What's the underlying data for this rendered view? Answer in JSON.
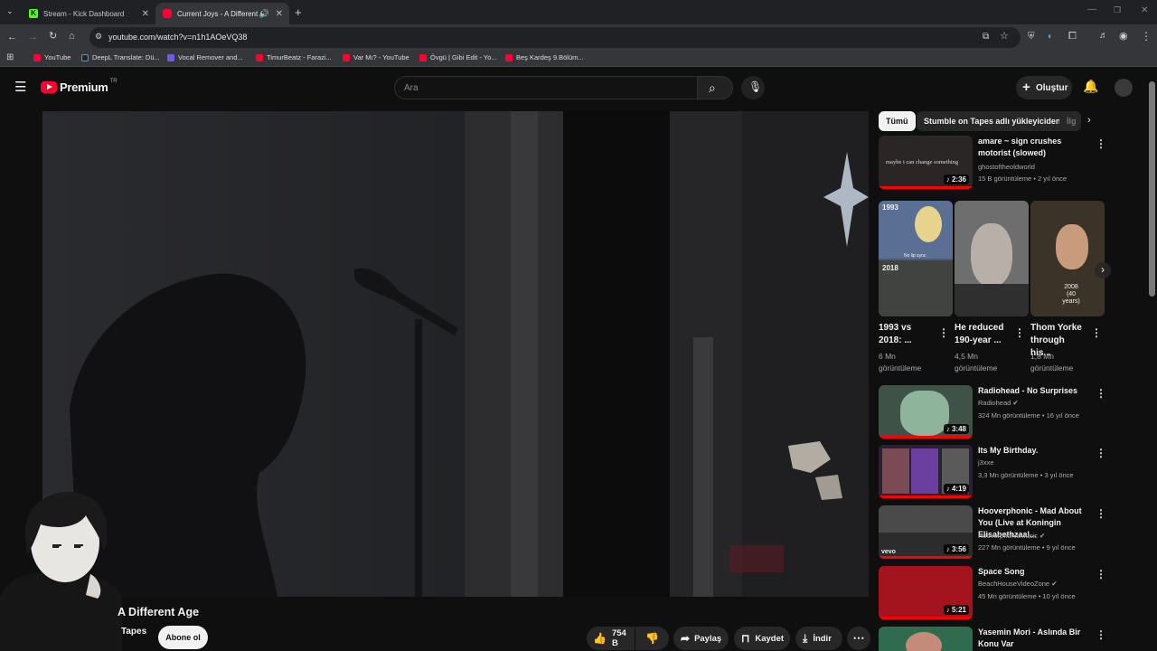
{
  "browser": {
    "tabs": [
      {
        "title": "Stream - Kick Dashboard",
        "favicon_color": "#53fc18"
      },
      {
        "title": "Current Joys - A Different A",
        "favicon_color": "#ff0033"
      }
    ],
    "url": "youtube.com/watch?v=n1h1AOeVQ38",
    "bookmarks": [
      {
        "label": "YouTube",
        "color": "#ff0033"
      },
      {
        "label": "DeepL Translate: Dü...",
        "color": "#0f2b46"
      },
      {
        "label": "Vocal Remover and...",
        "color": "#6c5ce7"
      },
      {
        "label": "TimurBeatz - Farazi...",
        "color": "#ff0033"
      },
      {
        "label": "Var Mı? - YouTube",
        "color": "#ff0033"
      },
      {
        "label": "Övgü | Gibi Edit - Yo...",
        "color": "#ff0033"
      },
      {
        "label": "Beş Kardeş 9.Bölüm...",
        "color": "#ff0033"
      }
    ]
  },
  "youtube": {
    "logo_text": "Premium",
    "logo_badge": "TR",
    "search_placeholder": "Ara",
    "create_label": "Oluştur"
  },
  "video": {
    "title": "A Different Age",
    "channel": "Tapes",
    "subscribe_label": "Abone ol",
    "likes": "754 B",
    "share_label": "Paylaş",
    "save_label": "Kaydet",
    "download_label": "İndir"
  },
  "chips": [
    "Tümü",
    "Stumble on Tapes adlı yükleyiciden",
    "İlg"
  ],
  "recommendations_top": [
    {
      "title": "amare ~ sign crushes motorist (slowed)",
      "channel": "ghostoftheoldworld",
      "meta": "15 B görüntüleme • 2 yıl önce",
      "duration": "2:36",
      "thumb_caption": "maybe i can change something"
    }
  ],
  "shorts": [
    {
      "title": "1993 vs 2018: ...",
      "views": "6 Mn görüntüleme",
      "caption_top": "1993",
      "caption_mid": "No lip sync",
      "caption_bottom": "2018"
    },
    {
      "title": "He reduced 190-year ...",
      "views": "4,5 Mn görüntüleme"
    },
    {
      "title": "Thom Yorke through his...",
      "views": "1,8 Mn görüntüleme",
      "caption_a": "2008",
      "caption_b": "(40 years)"
    }
  ],
  "recommendations": [
    {
      "title": "Radiohead - No Surprises",
      "channel": "Radiohead",
      "meta": "324 Mn görüntüleme • 16 yıl önce",
      "duration": "3:48"
    },
    {
      "title": "Its My Birthday.",
      "channel": "j3xxe",
      "meta": "3,3 Mn görüntüleme • 3 yıl önce",
      "duration": "4:19"
    },
    {
      "title": "Hooverphonic - Mad About You (Live at Koningin Elisabethzaal...",
      "channel": "HooverphonicMusic",
      "meta": "227 Mn görüntüleme • 9 yıl önce",
      "duration": "3:56",
      "badge": "vevo"
    },
    {
      "title": "Space Song",
      "channel": "BeachHouseVideoZone",
      "meta": "45 Mn görüntüleme • 10 yıl önce",
      "duration": "5:21"
    },
    {
      "title": "Yasemin Mori - Aslında Bir Konu Var",
      "channel": "",
      "meta": "",
      "duration": ""
    }
  ]
}
